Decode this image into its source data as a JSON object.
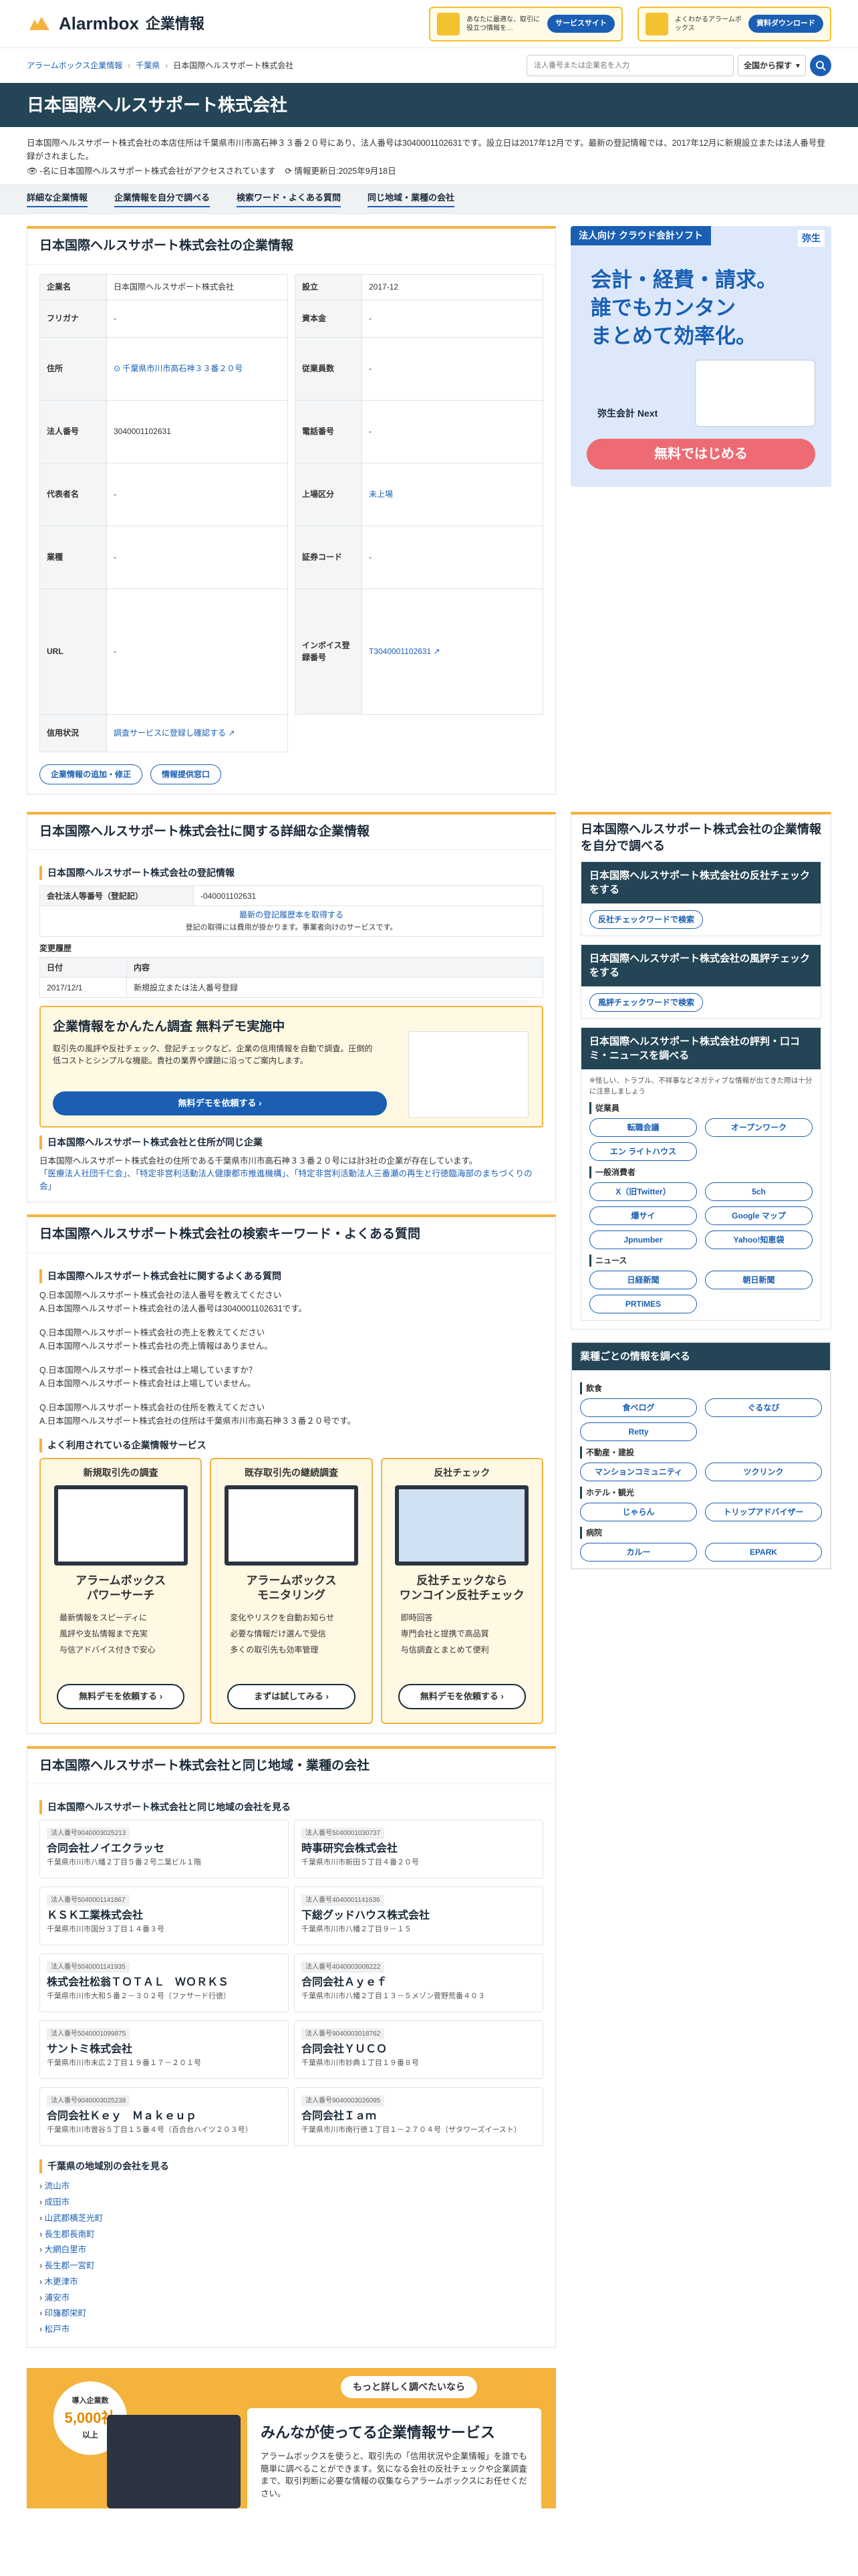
{
  "header": {
    "logo": "Alarmbox",
    "logo_sub": "企業情報",
    "banner1_text": "あなたに最適な、取引に役立つ情報を…",
    "banner1_btn": "サービスサイト",
    "banner2_text": "よくわかるアラームボックス",
    "banner2_btn": "資料ダウンロード"
  },
  "breadcrumb": [
    "アラームボックス企業情報",
    "千葉県",
    "日本国際ヘルスサポート株式会社"
  ],
  "search": {
    "placeholder": "法人番号または企業名を入力",
    "scope": "全国から探す"
  },
  "page_title": "日本国際ヘルスサポート株式会社",
  "intro": {
    "text": "日本国際ヘルスサポート株式会社の本店住所は千葉県市川市高石神３３番２０号にあり、法人番号は3040001102631です。設立日は2017年12月です。最新の登記情報では、2017年12月に新規設立または法人番号登録がされました。",
    "access": "-名に日本国際ヘルスサポート株式会社がアクセスされています",
    "updated": "情報更新日:2025年9月18日"
  },
  "tabs": [
    "詳細な企業情報",
    "企業情報を自分で調べる",
    "検索ワード・よくある質問",
    "同じ地域・業種の会社"
  ],
  "company_card": {
    "title": "日本国際ヘルスサポート株式会社の企業情報",
    "left": [
      {
        "k": "企業名",
        "v": "日本国際ヘルスサポート株式会社"
      },
      {
        "k": "フリガナ",
        "v": "-"
      },
      {
        "k": "住所",
        "v": "千葉県市川市高石神３３番２０号"
      },
      {
        "k": "法人番号",
        "v": "3040001102631"
      },
      {
        "k": "代表者名",
        "v": "-"
      },
      {
        "k": "業種",
        "v": "-"
      },
      {
        "k": "URL",
        "v": "-"
      },
      {
        "k": "信用状況",
        "v": "調査サービスに登録し確認する"
      }
    ],
    "right": [
      {
        "k": "設立",
        "v": "2017-12"
      },
      {
        "k": "資本金",
        "v": "-"
      },
      {
        "k": "従業員数",
        "v": "-"
      },
      {
        "k": "電話番号",
        "v": "-"
      },
      {
        "k": "上場区分",
        "v": "未上場"
      },
      {
        "k": "証券コード",
        "v": "-"
      },
      {
        "k": "インボイス登録番号",
        "v": "T3040001102631"
      }
    ],
    "btn_edit": "企業情報の追加・修正",
    "btn_report": "情報提供窓口"
  },
  "ad": {
    "tag": "法人向け クラウド会計ソフト",
    "brand": "弥生",
    "headline1": "会計・経費・請求。",
    "headline2": "誰でもカンタン",
    "headline3": "まとめて効率化。",
    "product": "弥生会計 Next",
    "cta": "無料ではじめる"
  },
  "detail": {
    "title": "日本国際ヘルスサポート株式会社に関する詳細な企業情報",
    "reg_title": "日本国際ヘルスサポート株式会社の登記情報",
    "reg_key": "会社法人等番号（登記記）",
    "reg_val": "-040001102631",
    "reg_link": "最新の登記履歴本を取得する",
    "reg_note": "登記の取得には費用が掛かります。事業者向けのサービスです。",
    "hist_label": "変更履歴",
    "hist_head": [
      "日付",
      "内容"
    ],
    "hist_rows": [
      [
        "2017/12/1",
        "新規設立または法人番号登録"
      ]
    ],
    "promo_title": "企業情報をかんたん調査 無料デモ実施中",
    "promo_text": "取引先の風評や反社チェック、登記チェックなど、企業の信用情報を自動で調査。圧倒的低コストとシンプルな機能。貴社の業界や課題に沿ってご案内します。",
    "promo_btn": "無料デモを依頼する",
    "same_addr_title": "日本国際ヘルスサポート株式会社と住所が同じ企業",
    "same_addr_text": "日本国際ヘルスサポート株式会社の住所である千葉県市川市高石神３３番２０号には計3社の企業が存在しています。",
    "same_addr_links": "「医療法人社団千仁会」、「特定非営利活動法人健康都市推進機構」、「特定非営利活動法人三番瀬の再生と行徳臨海部のまちづくりの会」"
  },
  "faq": {
    "title": "日本国際ヘルスサポート株式会社の検索キーワード・よくある質問",
    "sub": "日本国際ヘルスサポート株式会社に関するよくある質問",
    "items": [
      "Q.日本国際ヘルスサポート株式会社の法人番号を教えてください\nA.日本国際ヘルスサポート株式会社の法人番号は3040001102631です。",
      "Q.日本国際ヘルスサポート株式会社の売上を教えてください\nA.日本国際ヘルスサポート株式会社の売上情報はありません。",
      "Q.日本国際ヘルスサポート株式会社は上場していますか？\nA.日本国際ヘルスサポート株式会社は上場していません。",
      "Q.日本国際ヘルスサポート株式会社の住所を教えてください\nA.日本国際ヘルスサポート株式会社の住所は千葉県市川市高石神３３番２０号です。"
    ],
    "svc_title": "よく利用されている企業情報サービス",
    "services": [
      {
        "t": "新規取引先の調査",
        "n": "アラームボックス\nパワーサーチ",
        "f": [
          "最新情報をスピーディに",
          "風評や支払情報まで充実",
          "与信アドバイス付きで安心"
        ],
        "b": "無料デモを依頼する"
      },
      {
        "t": "既存取引先の継続調査",
        "n": "アラームボックス\nモニタリング",
        "f": [
          "変化やリスクを自動お知らせ",
          "必要な情報だけ選んで受信",
          "多くの取引先も効率管理"
        ],
        "b": "まずは試してみる"
      },
      {
        "t": "反社チェック",
        "n": "反社チェックなら\nワンコイン反社チェック",
        "f": [
          "即時回答",
          "専門会社と提携で高品質",
          "与信調査とまとめて便利"
        ],
        "b": "無料デモを依頼する"
      }
    ]
  },
  "same": {
    "title": "日本国際ヘルスサポート株式会社と同じ地域・業種の会社",
    "sub": "日本国際ヘルスサポート株式会社と同じ地域の会社を見る",
    "companies": [
      {
        "num": "法人番号9040003025213",
        "nm": "合同会社ノイエクラッセ",
        "ad": "千葉県市川市八幡２丁目５番２号二葉ビル１階"
      },
      {
        "num": "法人番号5040001030737",
        "nm": "時事研究会株式会社",
        "ad": "千葉県市川市新田５丁目４番２０号"
      },
      {
        "num": "法人番号5040001141867",
        "nm": "ＫＳＫ工業株式会社",
        "ad": "千葉県市川市国分３丁目１４番３号"
      },
      {
        "num": "法人番号4040001141636",
        "nm": "下総グッドハウス株式会社",
        "ad": "千葉県市川市八幡２丁目９－１５"
      },
      {
        "num": "法人番号5040001141935",
        "nm": "株式会社松翁ＴＯＴＡＬ　ＷＯＲＫＳ",
        "ad": "千葉県市川市大和５番２－３０２号（ファサード行徳）"
      },
      {
        "num": "法人番号4040003008222",
        "nm": "合同会社Ａｙｅｆ",
        "ad": "千葉県市川市八幡２丁目１３－５メゾン菅野荒番４０３"
      },
      {
        "num": "法人番号5040001099875",
        "nm": "サントミ株式会社",
        "ad": "千葉県市川市末広２丁目１９番１７－２０１号"
      },
      {
        "num": "法人番号9040003018762",
        "nm": "合同会社ＹＵＣＯ",
        "ad": "千葉県市川市妙典１丁目１９番８号"
      },
      {
        "num": "法人番号9040003025238",
        "nm": "合同会社Ｋｅｙ　Ｍａｋｅｕｐ",
        "ad": "千葉県市川市曽谷５丁目１５番４号（百合台ハイツ２０３号）"
      },
      {
        "num": "法人番号9040003026095",
        "nm": "合同会社Ｉａｍ",
        "ad": "千葉県市川市南行徳１丁目１－２７０４号（ザタワーズイースト）"
      }
    ],
    "pref_title": "千葉県の地域別の会社を見る",
    "prefs": [
      "流山市",
      "成田市",
      "山武郡横芝光町",
      "長生郡長南町",
      "大網白里市",
      "長生郡一宮町",
      "木更津市",
      "浦安市",
      "印旛郡栄町",
      "松戸市"
    ]
  },
  "sidebar": {
    "title": "日本国際ヘルスサポート株式会社の企業情報を自分で調べる",
    "b1_title": "日本国際ヘルスサポート株式会社の反社チェックをする",
    "b1_btn": "反社チェックワードで検索",
    "b2_title": "日本国際ヘルスサポート株式会社の風評チェックをする",
    "b2_btn": "風評チェックワードで検索",
    "b3_title": "日本国際ヘルスサポート株式会社の評判・口コミ・ニュースを調べる",
    "b3_note": "※怪しい、トラブル、不祥事などネガティブな情報が出てきた際は十分に注意しましょう",
    "g1": "従業員",
    "g1_items": [
      "転職会議",
      "オープンワーク",
      "エン ライトハウス"
    ],
    "g2": "一般消費者",
    "g2_items": [
      "X（旧Twitter）",
      "5ch",
      "爆サイ",
      "Google マップ",
      "Jpnumber",
      "Yahoo!知恵袋"
    ],
    "g3": "ニュース",
    "g3_items": [
      "日経新聞",
      "朝日新聞",
      "PRTIMES"
    ],
    "ind_title": "業種ごとの情報を調べる",
    "i1": "飲食",
    "i1_items": [
      "食べログ",
      "ぐるなび",
      "Retty"
    ],
    "i2": "不動産・建設",
    "i2_items": [
      "マンションコミュニティ",
      "ツクリンク"
    ],
    "i3": "ホテル・観光",
    "i3_items": [
      "じゃらん",
      "トリップアドバイザー"
    ],
    "i4": "病院",
    "i4_items": [
      "カルー",
      "EPARK"
    ]
  },
  "footpromo": {
    "bubble": "もっと詳しく調べたいなら",
    "badge1": "導入企業数",
    "badge2": "5,000社",
    "badge3": "以上",
    "title": "みんなが使ってる企業情報サービス",
    "text": "アラームボックスを使うと、取引先の「信用状況や企業情報」を誰でも簡単に調べることができます。気になる会社の反社チェックや企業調査まで、取引判断に必要な情報の収集ならアラームボックスにお任せください。"
  }
}
